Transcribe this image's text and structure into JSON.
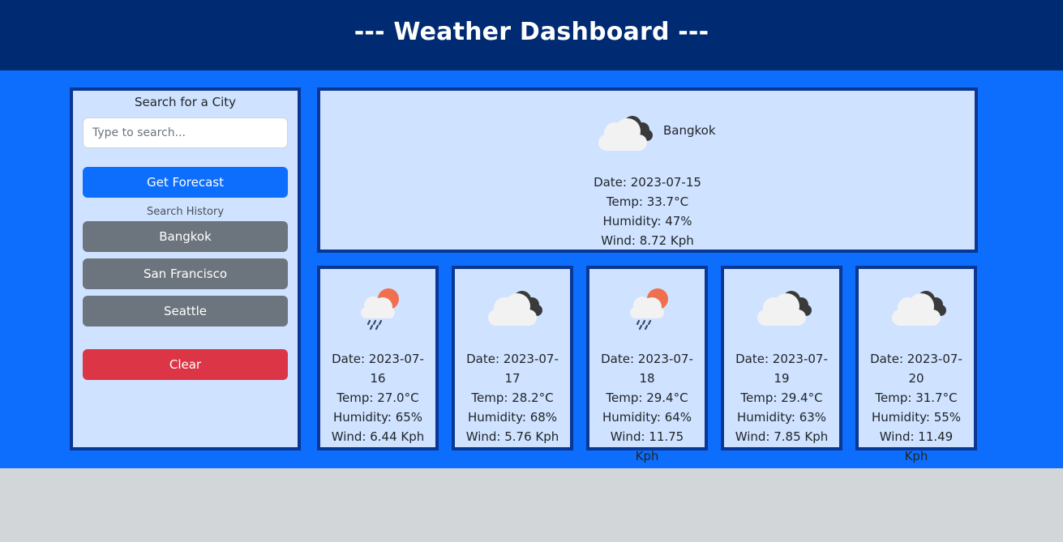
{
  "header": {
    "title": "--- Weather Dashboard ---"
  },
  "sidebar": {
    "search_label": "Search for a City",
    "search_placeholder": "Type to search...",
    "search_value": "",
    "get_forecast_label": "Get Forecast",
    "history_label": "Search History",
    "history": [
      {
        "label": "Bangkok"
      },
      {
        "label": "San Francisco"
      },
      {
        "label": "Seattle"
      }
    ],
    "clear_label": "Clear"
  },
  "current": {
    "city": "Bangkok",
    "icon": "cloudy-icon",
    "date": "Date: 2023-07-15",
    "temp": "Temp: 33.7°C",
    "humidity": "Humidity: 47%",
    "wind": "Wind: 8.72 Kph"
  },
  "forecast": [
    {
      "icon": "rain-sun-icon",
      "date": "Date: 2023-07-16",
      "temp": "Temp: 27.0°C",
      "humidity": "Humidity: 65%",
      "wind": "Wind: 6.44 Kph"
    },
    {
      "icon": "cloudy-icon",
      "date": "Date: 2023-07-17",
      "temp": "Temp: 28.2°C",
      "humidity": "Humidity: 68%",
      "wind": "Wind: 5.76 Kph"
    },
    {
      "icon": "rain-sun-icon",
      "date": "Date: 2023-07-18",
      "temp": "Temp: 29.4°C",
      "humidity": "Humidity: 64%",
      "wind": "Wind: 11.75 Kph"
    },
    {
      "icon": "cloudy-icon",
      "date": "Date: 2023-07-19",
      "temp": "Temp: 29.4°C",
      "humidity": "Humidity: 63%",
      "wind": "Wind: 7.85 Kph"
    },
    {
      "icon": "cloudy-icon",
      "date": "Date: 2023-07-20",
      "temp": "Temp: 31.7°C",
      "humidity": "Humidity: 55%",
      "wind": "Wind: 11.49 Kph"
    }
  ],
  "colors": {
    "header_bg": "#002b73",
    "main_bg": "#0d6efd",
    "panel_bg": "#cfe2ff",
    "panel_border": "#0a3694",
    "primary": "#0d6efd",
    "secondary": "#6c757d",
    "danger": "#dc3545",
    "footer_bg": "#d3d6d9"
  }
}
